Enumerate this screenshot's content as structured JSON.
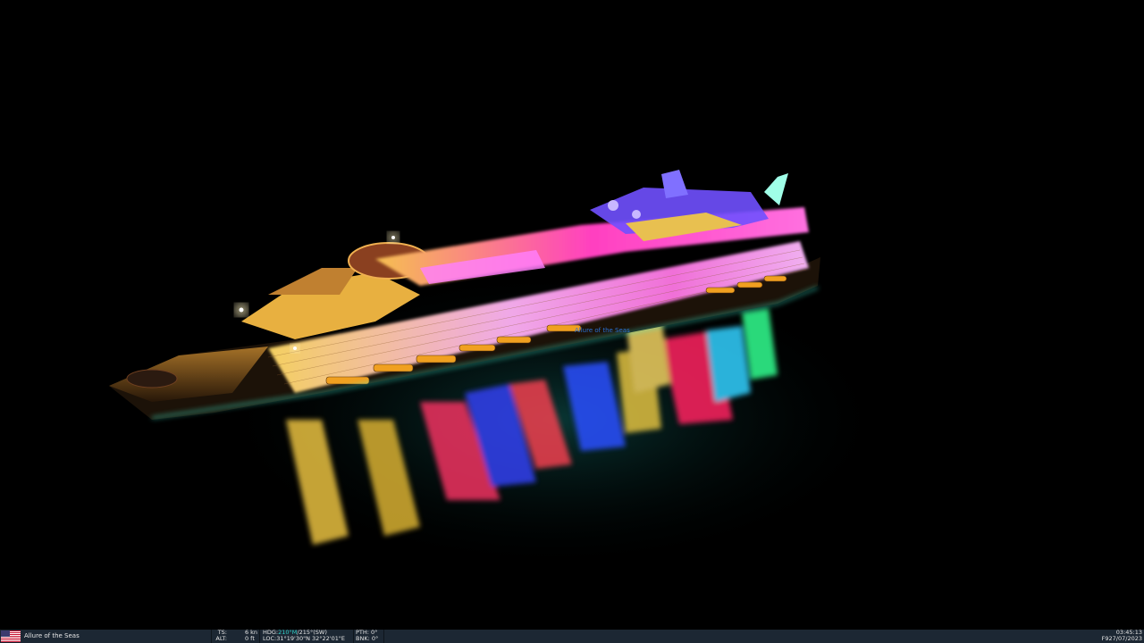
{
  "scene": {
    "vessel_label": "Allure of the Seas",
    "colors": {
      "sky": "#000000",
      "water": "#001a1c",
      "hull": "#1a1208",
      "deck_glow_yellow": "#f2c84a",
      "deck_glow_pink": "#e85cf0",
      "deck_glow_magenta": "#ff2fb4",
      "funnel_blue": "#6a4cff",
      "mast_teal": "#8ff0e0"
    }
  },
  "hud": {
    "flag_icon": "us-flag-icon",
    "vessel_name": "Allure of the Seas",
    "ts_label": "TS:",
    "ts_value": "6",
    "ts_unit": "kn",
    "alt_label": "ALT:",
    "alt_value": "0",
    "alt_unit": "ft",
    "hdg_label": "HDG:",
    "hdg_mag": "210°M",
    "hdg_sep": "/",
    "hdg_true": "215°(SW)",
    "loc_label": "LOC:",
    "loc_value": "31°19'30\"N 32°22'01\"E",
    "pth_label": "PTH:",
    "pth_value": "0°",
    "bnk_label": "BNK:",
    "bnk_value": "0°",
    "time": "03:45:13",
    "date_prefix": "F9",
    "date": "27/07/2023"
  }
}
